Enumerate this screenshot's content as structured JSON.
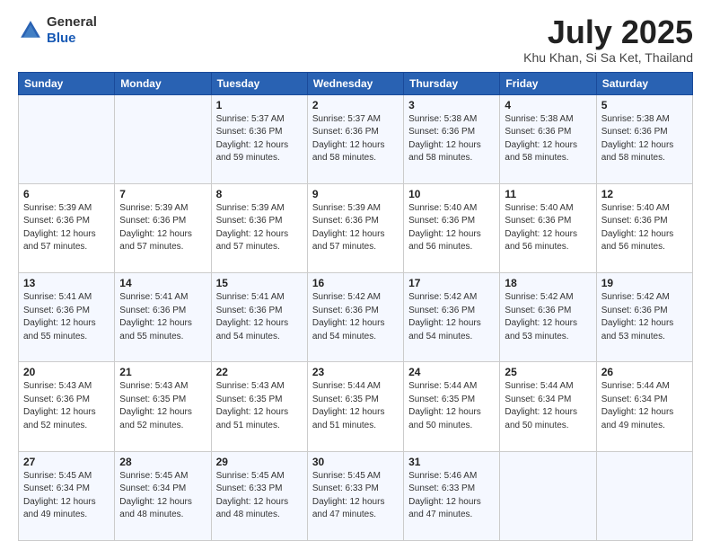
{
  "header": {
    "logo_line1": "General",
    "logo_line2": "Blue",
    "month_title": "July 2025",
    "location": "Khu Khan, Si Sa Ket, Thailand"
  },
  "weekdays": [
    "Sunday",
    "Monday",
    "Tuesday",
    "Wednesday",
    "Thursday",
    "Friday",
    "Saturday"
  ],
  "weeks": [
    [
      {
        "day": "",
        "detail": ""
      },
      {
        "day": "",
        "detail": ""
      },
      {
        "day": "1",
        "detail": "Sunrise: 5:37 AM\nSunset: 6:36 PM\nDaylight: 12 hours and 59 minutes."
      },
      {
        "day": "2",
        "detail": "Sunrise: 5:37 AM\nSunset: 6:36 PM\nDaylight: 12 hours and 58 minutes."
      },
      {
        "day": "3",
        "detail": "Sunrise: 5:38 AM\nSunset: 6:36 PM\nDaylight: 12 hours and 58 minutes."
      },
      {
        "day": "4",
        "detail": "Sunrise: 5:38 AM\nSunset: 6:36 PM\nDaylight: 12 hours and 58 minutes."
      },
      {
        "day": "5",
        "detail": "Sunrise: 5:38 AM\nSunset: 6:36 PM\nDaylight: 12 hours and 58 minutes."
      }
    ],
    [
      {
        "day": "6",
        "detail": "Sunrise: 5:39 AM\nSunset: 6:36 PM\nDaylight: 12 hours and 57 minutes."
      },
      {
        "day": "7",
        "detail": "Sunrise: 5:39 AM\nSunset: 6:36 PM\nDaylight: 12 hours and 57 minutes."
      },
      {
        "day": "8",
        "detail": "Sunrise: 5:39 AM\nSunset: 6:36 PM\nDaylight: 12 hours and 57 minutes."
      },
      {
        "day": "9",
        "detail": "Sunrise: 5:39 AM\nSunset: 6:36 PM\nDaylight: 12 hours and 57 minutes."
      },
      {
        "day": "10",
        "detail": "Sunrise: 5:40 AM\nSunset: 6:36 PM\nDaylight: 12 hours and 56 minutes."
      },
      {
        "day": "11",
        "detail": "Sunrise: 5:40 AM\nSunset: 6:36 PM\nDaylight: 12 hours and 56 minutes."
      },
      {
        "day": "12",
        "detail": "Sunrise: 5:40 AM\nSunset: 6:36 PM\nDaylight: 12 hours and 56 minutes."
      }
    ],
    [
      {
        "day": "13",
        "detail": "Sunrise: 5:41 AM\nSunset: 6:36 PM\nDaylight: 12 hours and 55 minutes."
      },
      {
        "day": "14",
        "detail": "Sunrise: 5:41 AM\nSunset: 6:36 PM\nDaylight: 12 hours and 55 minutes."
      },
      {
        "day": "15",
        "detail": "Sunrise: 5:41 AM\nSunset: 6:36 PM\nDaylight: 12 hours and 54 minutes."
      },
      {
        "day": "16",
        "detail": "Sunrise: 5:42 AM\nSunset: 6:36 PM\nDaylight: 12 hours and 54 minutes."
      },
      {
        "day": "17",
        "detail": "Sunrise: 5:42 AM\nSunset: 6:36 PM\nDaylight: 12 hours and 54 minutes."
      },
      {
        "day": "18",
        "detail": "Sunrise: 5:42 AM\nSunset: 6:36 PM\nDaylight: 12 hours and 53 minutes."
      },
      {
        "day": "19",
        "detail": "Sunrise: 5:42 AM\nSunset: 6:36 PM\nDaylight: 12 hours and 53 minutes."
      }
    ],
    [
      {
        "day": "20",
        "detail": "Sunrise: 5:43 AM\nSunset: 6:36 PM\nDaylight: 12 hours and 52 minutes."
      },
      {
        "day": "21",
        "detail": "Sunrise: 5:43 AM\nSunset: 6:35 PM\nDaylight: 12 hours and 52 minutes."
      },
      {
        "day": "22",
        "detail": "Sunrise: 5:43 AM\nSunset: 6:35 PM\nDaylight: 12 hours and 51 minutes."
      },
      {
        "day": "23",
        "detail": "Sunrise: 5:44 AM\nSunset: 6:35 PM\nDaylight: 12 hours and 51 minutes."
      },
      {
        "day": "24",
        "detail": "Sunrise: 5:44 AM\nSunset: 6:35 PM\nDaylight: 12 hours and 50 minutes."
      },
      {
        "day": "25",
        "detail": "Sunrise: 5:44 AM\nSunset: 6:34 PM\nDaylight: 12 hours and 50 minutes."
      },
      {
        "day": "26",
        "detail": "Sunrise: 5:44 AM\nSunset: 6:34 PM\nDaylight: 12 hours and 49 minutes."
      }
    ],
    [
      {
        "day": "27",
        "detail": "Sunrise: 5:45 AM\nSunset: 6:34 PM\nDaylight: 12 hours and 49 minutes."
      },
      {
        "day": "28",
        "detail": "Sunrise: 5:45 AM\nSunset: 6:34 PM\nDaylight: 12 hours and 48 minutes."
      },
      {
        "day": "29",
        "detail": "Sunrise: 5:45 AM\nSunset: 6:33 PM\nDaylight: 12 hours and 48 minutes."
      },
      {
        "day": "30",
        "detail": "Sunrise: 5:45 AM\nSunset: 6:33 PM\nDaylight: 12 hours and 47 minutes."
      },
      {
        "day": "31",
        "detail": "Sunrise: 5:46 AM\nSunset: 6:33 PM\nDaylight: 12 hours and 47 minutes."
      },
      {
        "day": "",
        "detail": ""
      },
      {
        "day": "",
        "detail": ""
      }
    ]
  ]
}
